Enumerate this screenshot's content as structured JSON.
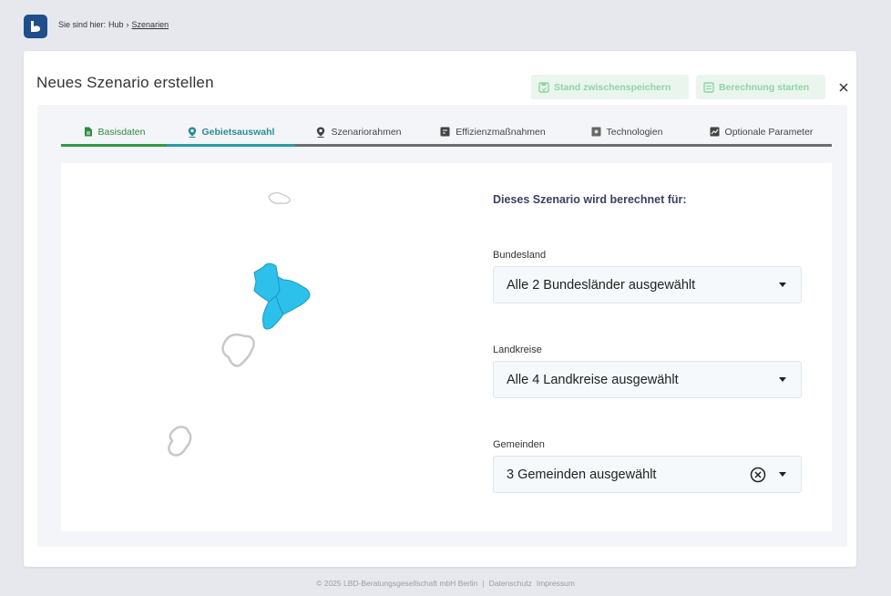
{
  "breadcrumb": {
    "prefix": "Sie sind hier:",
    "hub": "Hub",
    "separator": "›",
    "current": "Szenarien"
  },
  "page": {
    "title": "Neues Szenario erstellen"
  },
  "header_buttons": {
    "save": "Stand zwischenspeichern",
    "calculate": "Berechnung starten"
  },
  "tabs": [
    {
      "label": "Basisdaten",
      "icon": "document-icon",
      "state": "done"
    },
    {
      "label": "Gebietsauswahl",
      "icon": "map-pin-icon",
      "state": "active"
    },
    {
      "label": "Szenariorahmen",
      "icon": "map-pin-icon",
      "state": "default"
    },
    {
      "label": "Effizienzmaßnahmen",
      "icon": "list-icon",
      "state": "default"
    },
    {
      "label": "Technologien",
      "icon": "chip-icon",
      "state": "default"
    },
    {
      "label": "Optionale Parameter",
      "icon": "chart-icon",
      "state": "default"
    }
  ],
  "form": {
    "title": "Dieses Szenario wird berechnet für:",
    "bundesland": {
      "label": "Bundesland",
      "value": "Alle 2 Bundesländer ausgewählt"
    },
    "landkreise": {
      "label": "Landkreise",
      "value": "Alle 4 Landkreise ausgewählt"
    },
    "gemeinden": {
      "label": "Gemeinden",
      "value": "3 Gemeinden ausgewählt"
    }
  },
  "footer": {
    "copyright": "© 2025 LBD-Beratungsgesellschaft mbH Berlin",
    "separator": "|",
    "privacy": "Datenschutz",
    "imprint": "Impressum"
  },
  "colors": {
    "accent_green": "#2e9a45",
    "accent_teal": "#2a9aa5",
    "map_fill": "#2cc0ea",
    "button_bg": "#eaf5ee"
  }
}
